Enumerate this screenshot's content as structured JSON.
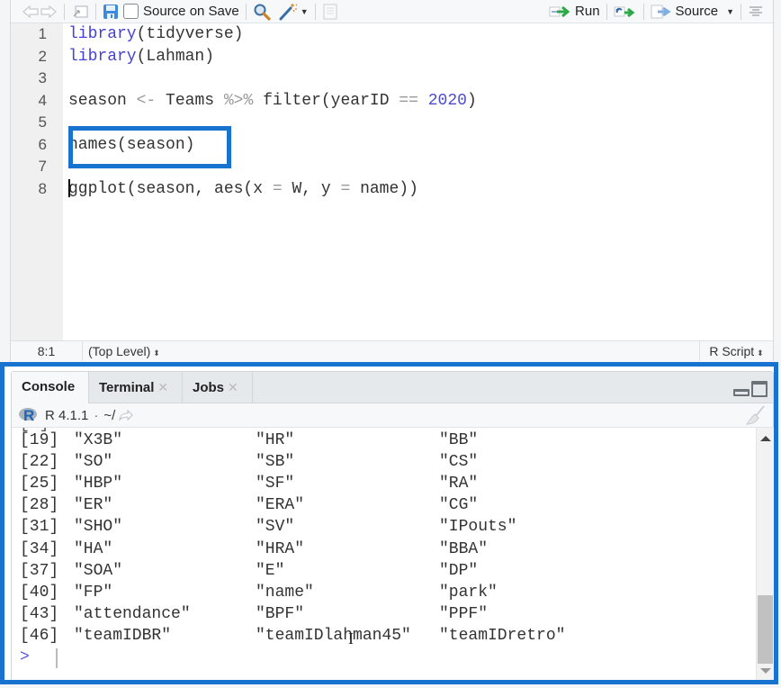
{
  "editor": {
    "toolbar": {
      "source_on_save_label": "Source on Save",
      "source_on_save_checked": false,
      "run_label": "Run",
      "source_label": "Source"
    },
    "lines": [
      {
        "n": "1",
        "parts": [
          {
            "t": "library",
            "c": "kw"
          },
          {
            "t": "(tidyverse)",
            "c": ""
          }
        ]
      },
      {
        "n": "2",
        "parts": [
          {
            "t": "library",
            "c": "kw"
          },
          {
            "t": "(Lahman)",
            "c": ""
          }
        ]
      },
      {
        "n": "3",
        "parts": []
      },
      {
        "n": "4",
        "parts": [
          {
            "t": "season ",
            "c": ""
          },
          {
            "t": "<-",
            "c": "op"
          },
          {
            "t": " Teams ",
            "c": ""
          },
          {
            "t": "%>%",
            "c": "op"
          },
          {
            "t": " filter(yearID ",
            "c": ""
          },
          {
            "t": "==",
            "c": "op"
          },
          {
            "t": " ",
            "c": ""
          },
          {
            "t": "2020",
            "c": "num"
          },
          {
            "t": ")",
            "c": ""
          }
        ]
      },
      {
        "n": "5",
        "parts": []
      },
      {
        "n": "6",
        "parts": [
          {
            "t": "names(season)",
            "c": ""
          }
        ]
      },
      {
        "n": "7",
        "parts": []
      },
      {
        "n": "8",
        "parts": [
          {
            "t": "ggplot(season, aes(x ",
            "c": ""
          },
          {
            "t": "=",
            "c": "op"
          },
          {
            "t": " W, y ",
            "c": ""
          },
          {
            "t": "=",
            "c": "op"
          },
          {
            "t": " name))",
            "c": ""
          }
        ],
        "cursor": true
      }
    ],
    "status": {
      "position": "8:1",
      "scope": "(Top Level)",
      "file_type": "R Script"
    }
  },
  "console": {
    "tabs": [
      {
        "label": "Console",
        "closable": false,
        "active": true
      },
      {
        "label": "Terminal",
        "closable": true,
        "active": false
      },
      {
        "label": "Jobs",
        "closable": true,
        "active": false
      }
    ],
    "r_version": "R 4.1.1",
    "working_dir": "~/",
    "output_rows": [
      {
        "index": "[19]",
        "values": [
          "\"X3B\"",
          "\"HR\"",
          "\"BB\""
        ]
      },
      {
        "index": "[22]",
        "values": [
          "\"SO\"",
          "\"SB\"",
          "\"CS\""
        ]
      },
      {
        "index": "[25]",
        "values": [
          "\"HBP\"",
          "\"SF\"",
          "\"RA\""
        ]
      },
      {
        "index": "[28]",
        "values": [
          "\"ER\"",
          "\"ERA\"",
          "\"CG\""
        ]
      },
      {
        "index": "[31]",
        "values": [
          "\"SHO\"",
          "\"SV\"",
          "\"IPouts\""
        ]
      },
      {
        "index": "[34]",
        "values": [
          "\"HA\"",
          "\"HRA\"",
          "\"BBA\""
        ]
      },
      {
        "index": "[37]",
        "values": [
          "\"SOA\"",
          "\"E\"",
          "\"DP\""
        ]
      },
      {
        "index": "[40]",
        "values": [
          "\"FP\"",
          "\"name\"",
          "\"park\""
        ]
      },
      {
        "index": "[43]",
        "values": [
          "\"attendance\"",
          "\"BPF\"",
          "\"PPF\""
        ]
      },
      {
        "index": "[46]",
        "values": [
          "\"teamIDBR\"",
          "\"teamIDlahman45\"",
          "\"teamIDretro\""
        ]
      }
    ],
    "prompt": ">"
  },
  "colors": {
    "highlight": "#1872d0",
    "keyword": "#4440d8",
    "number": "#4d4dcc"
  }
}
